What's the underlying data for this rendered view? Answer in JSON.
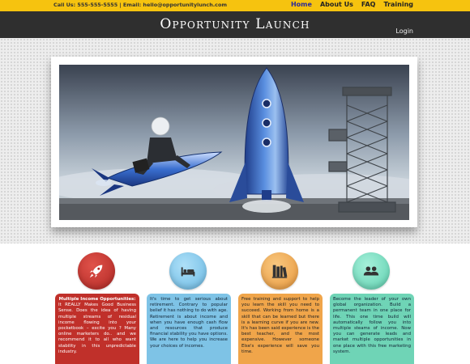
{
  "topbar": {
    "contact": "Call Us: 555-555-5555  |  Email: hello@opportunitylunch.com",
    "nav": [
      "Home",
      "About Us",
      "FAQ",
      "Training"
    ]
  },
  "header": {
    "brand": "Opportunity Launch",
    "login": "Login"
  },
  "colors": {
    "topbar": "#f6c30f",
    "header": "#2f2f2f",
    "red": "#c0302a",
    "blue": "#7ec3e6",
    "orange": "#f0a54a",
    "green": "#6fd4b6"
  },
  "features": [
    {
      "icon": "rocket-icon",
      "title": "Multiple Income Opportunities:",
      "text": "It REALLY Makes Good Business Sense. Does the idea of having multiple streams of residual income flowing into your pocketbook – excite you ? Many online marketers do.. and we recommend it to all who want stability in this unpredictable industry."
    },
    {
      "icon": "bed-icon",
      "text": "It's time to get serious about retirement. Contrary to popular belief it has nothing to do with age. Retirement is about income and when you have enough cash flow and resources that produce financial stability you have options. We are here to help you increase your choices of incomes."
    },
    {
      "icon": "books-icon",
      "text": "Free training and support to help you learn the skill you need to succeed. Working from home is a skill that can be learned but there is a learning curve if you are new. It's has been said experience is the best teacher, and the most expensive. However someone Else's experience will save you time."
    },
    {
      "icon": "users-icon",
      "text": "Become the leader of your own global organization. Build a permanent team in one place for life. This one time build will automatically follow you into multiple steams of income. Now you can generate leads and market multiple opportunities in one place with this free marketing system."
    }
  ]
}
